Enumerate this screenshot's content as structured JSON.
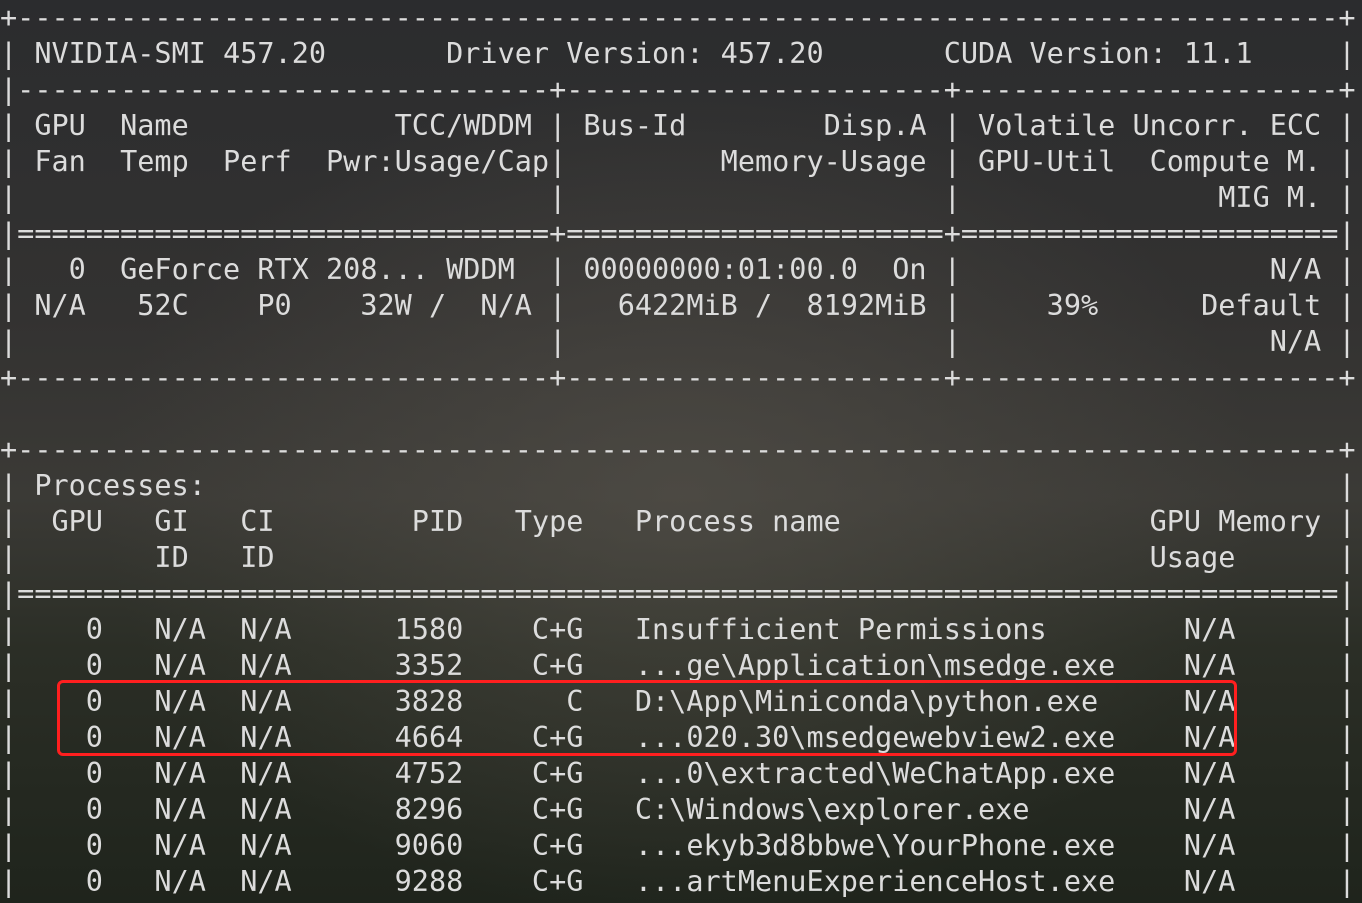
{
  "terminal": {
    "highlight_color": "#ff1f1f",
    "text_color": "#dcdcdc",
    "lines": [
      "+-----------------------------------------------------------------------------+",
      "| NVIDIA-SMI 457.20       Driver Version: 457.20       CUDA Version: 11.1     |",
      "|-------------------------------+----------------------+----------------------+",
      "| GPU  Name            TCC/WDDM | Bus-Id        Disp.A | Volatile Uncorr. ECC |",
      "| Fan  Temp  Perf  Pwr:Usage/Cap|         Memory-Usage | GPU-Util  Compute M. |",
      "|                               |                      |               MIG M. |",
      "|===============================+======================+======================|",
      "|   0  GeForce RTX 208... WDDM  | 00000000:01:00.0  On |                  N/A |",
      "| N/A   52C    P0    32W /  N/A |   6422MiB /  8192MiB |     39%      Default |",
      "|                               |                      |                  N/A |",
      "+-------------------------------+----------------------+----------------------+",
      "",
      "+-----------------------------------------------------------------------------+",
      "| Processes:                                                                  |",
      "|  GPU   GI   CI        PID   Type   Process name                  GPU Memory |",
      "|        ID   ID                                                   Usage      |",
      "|=============================================================================|",
      "|    0   N/A  N/A      1580    C+G   Insufficient Permissions        N/A      |",
      "|    0   N/A  N/A      3352    C+G   ...ge\\Application\\msedge.exe    N/A      |",
      "|    0   N/A  N/A      3828      C   D:\\App\\Miniconda\\python.exe     N/A      |",
      "|    0   N/A  N/A      4664    C+G   ...020.30\\msedgewebview2.exe    N/A      |",
      "|    0   N/A  N/A      4752    C+G   ...0\\extracted\\WeChatApp.exe    N/A      |",
      "|    0   N/A  N/A      8296    C+G   C:\\Windows\\explorer.exe         N/A      |",
      "|    0   N/A  N/A      9060    C+G   ...ekyb3d8bbwe\\YourPhone.exe    N/A      |",
      "|    0   N/A  N/A      9288    C+G   ...artMenuExperienceHost.exe    N/A      |"
    ]
  }
}
